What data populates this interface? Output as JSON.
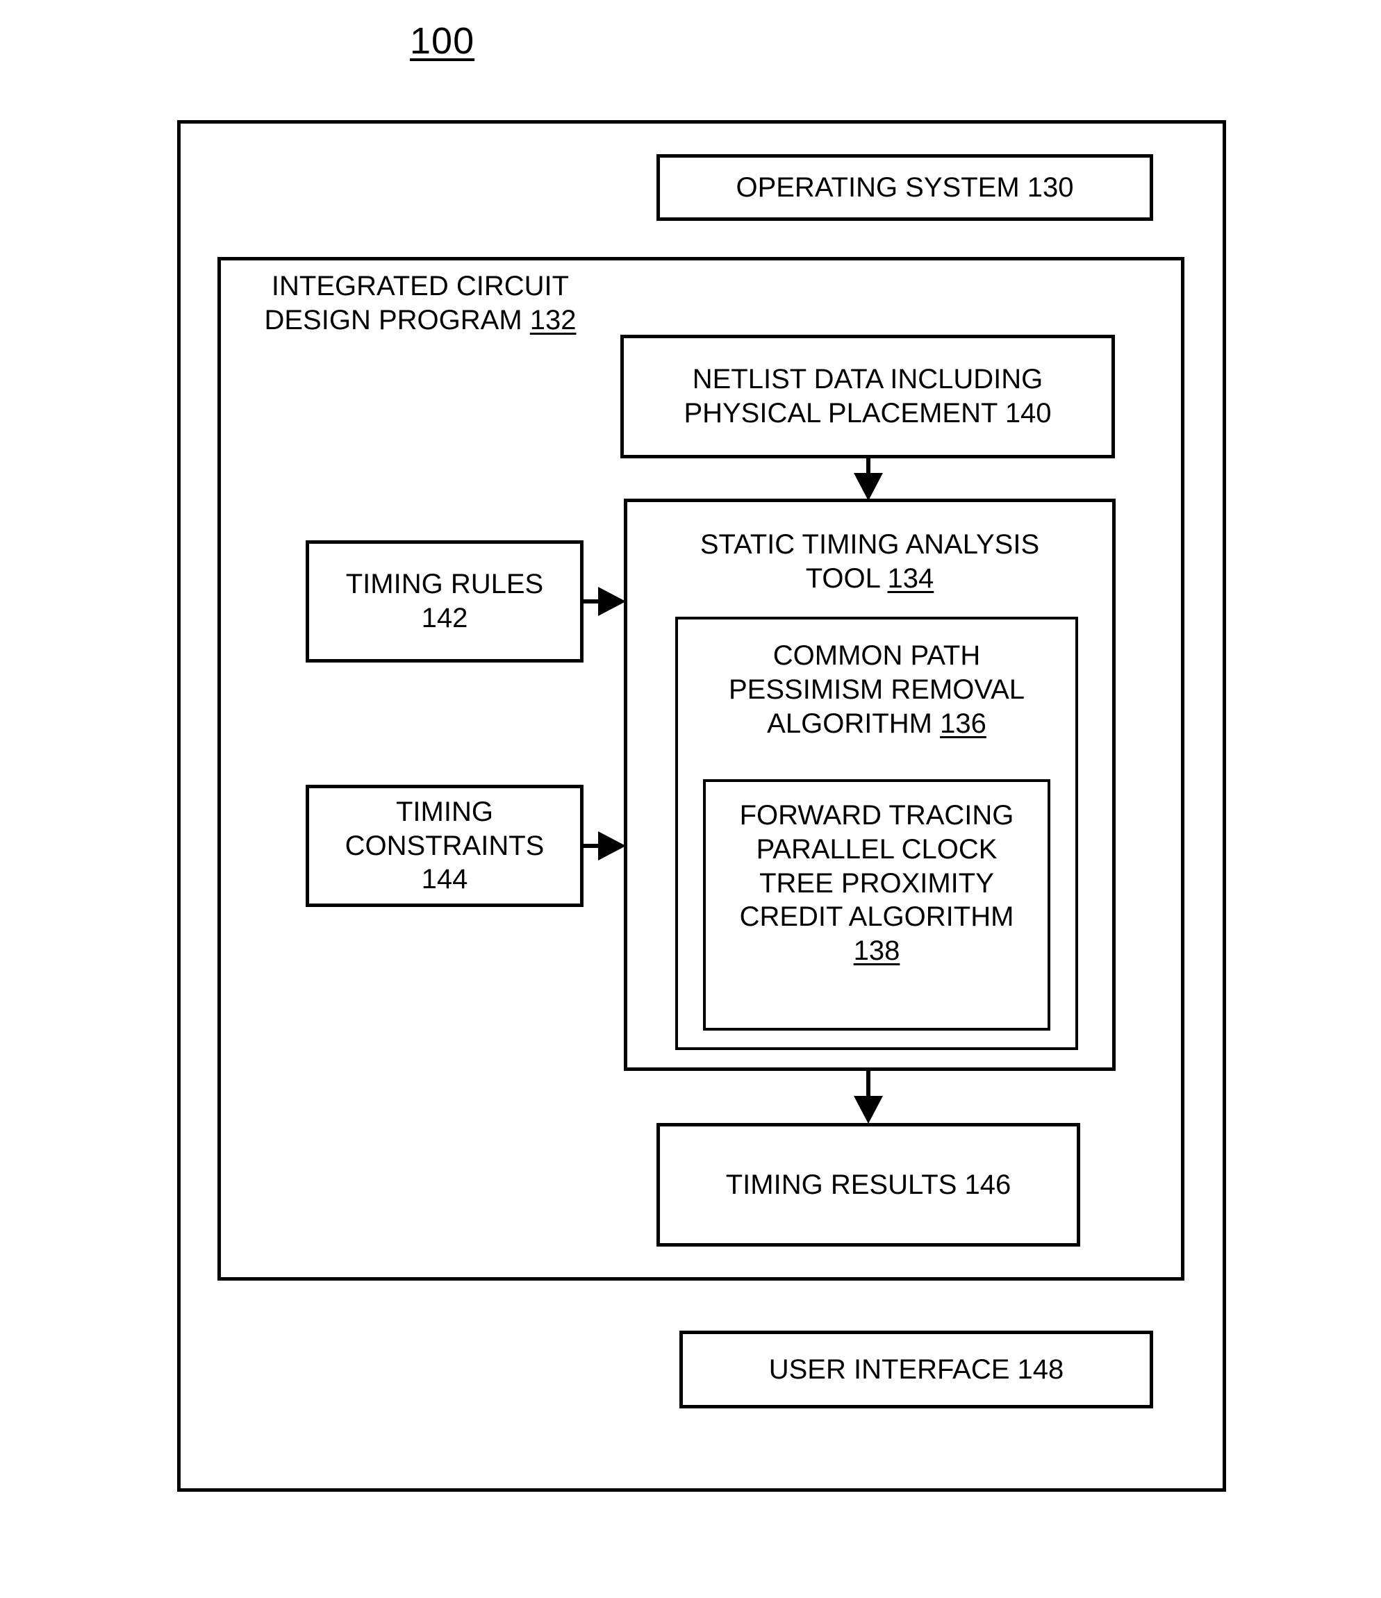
{
  "figure": {
    "number": "100"
  },
  "system": {
    "name": "system-container"
  },
  "blocks": {
    "operating_system": {
      "text": "OPERATING SYSTEM ",
      "ref": "130"
    },
    "design_program": {
      "text": "INTEGRATED CIRCUIT\nDESIGN PROGRAM ",
      "ref": "132"
    },
    "netlist_data": {
      "text": "NETLIST DATA INCLUDING\nPHYSICAL PLACEMENT\n",
      "ref": "140"
    },
    "timing_rules": {
      "text": "TIMING RULES\n",
      "ref": "142"
    },
    "timing_constraints": {
      "text": "TIMING\nCONSTRAINTS\n",
      "ref": "144"
    },
    "static_timing_analysis_tool": {
      "text": "STATIC TIMING ANALYSIS\nTOOL ",
      "ref": "134"
    },
    "cppr_algorithm": {
      "text": "COMMON PATH\nPESSIMISM REMOVAL\nALGORITHM ",
      "ref": "136"
    },
    "forward_tracing_algorithm": {
      "text": "FORWARD TRACING\nPARALLEL  CLOCK\nTREE  PROXIMITY\nCREDIT ALGORITHM\n",
      "ref": "138"
    },
    "timing_results": {
      "text": "TIMING RESULTS\n",
      "ref": "146"
    },
    "user_interface": {
      "text": "USER INTERFACE ",
      "ref": "148"
    }
  },
  "arrows": [
    {
      "name": "netlist-to-sta",
      "direction": "down"
    },
    {
      "name": "sta-to-timing-results",
      "direction": "down"
    },
    {
      "name": "timing-rules-to-sta",
      "direction": "right"
    },
    {
      "name": "timing-constraints-to-sta",
      "direction": "right"
    }
  ],
  "colors": {
    "stroke": "#000000",
    "background": "#ffffff"
  }
}
